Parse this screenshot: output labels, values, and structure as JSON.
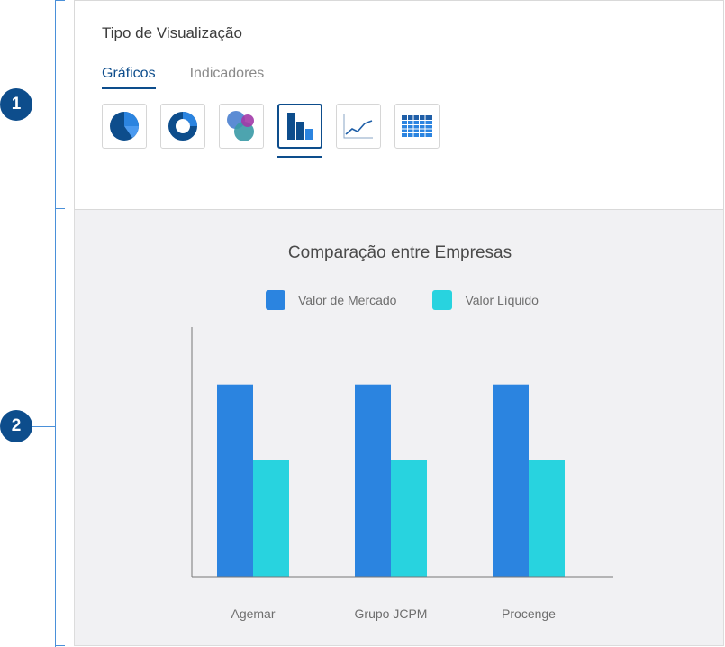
{
  "annotations": {
    "marker1": "1",
    "marker2": "2"
  },
  "panel": {
    "title": "Tipo de Visualização",
    "tabs": [
      {
        "label": "Gráficos",
        "active": true
      },
      {
        "label": "Indicadores",
        "active": false
      }
    ],
    "chart_types": [
      {
        "icon": "pie-chart-icon",
        "selected": false
      },
      {
        "icon": "donut-chart-icon",
        "selected": false
      },
      {
        "icon": "bubble-chart-icon",
        "selected": false
      },
      {
        "icon": "bar-chart-icon",
        "selected": true
      },
      {
        "icon": "line-chart-icon",
        "selected": false
      },
      {
        "icon": "table-icon",
        "selected": false
      }
    ]
  },
  "colors": {
    "accent": "#0d4d8c",
    "series1": "#2b84e0",
    "series2": "#28d3df",
    "panel_bg": "#f1f1f3"
  },
  "chart_data": {
    "type": "bar",
    "title": "Comparação entre Empresas",
    "categories": [
      "Agemar",
      "Grupo JCPM",
      "Procenge"
    ],
    "series": [
      {
        "name": "Valor de Mercado",
        "values": [
          79,
          79,
          79
        ]
      },
      {
        "name": "Valor Líquido",
        "values": [
          48,
          48,
          48
        ]
      }
    ],
    "ylim": [
      0,
      100
    ],
    "xlabel": "",
    "ylabel": "",
    "grid": false,
    "legend_position": "top-center"
  }
}
